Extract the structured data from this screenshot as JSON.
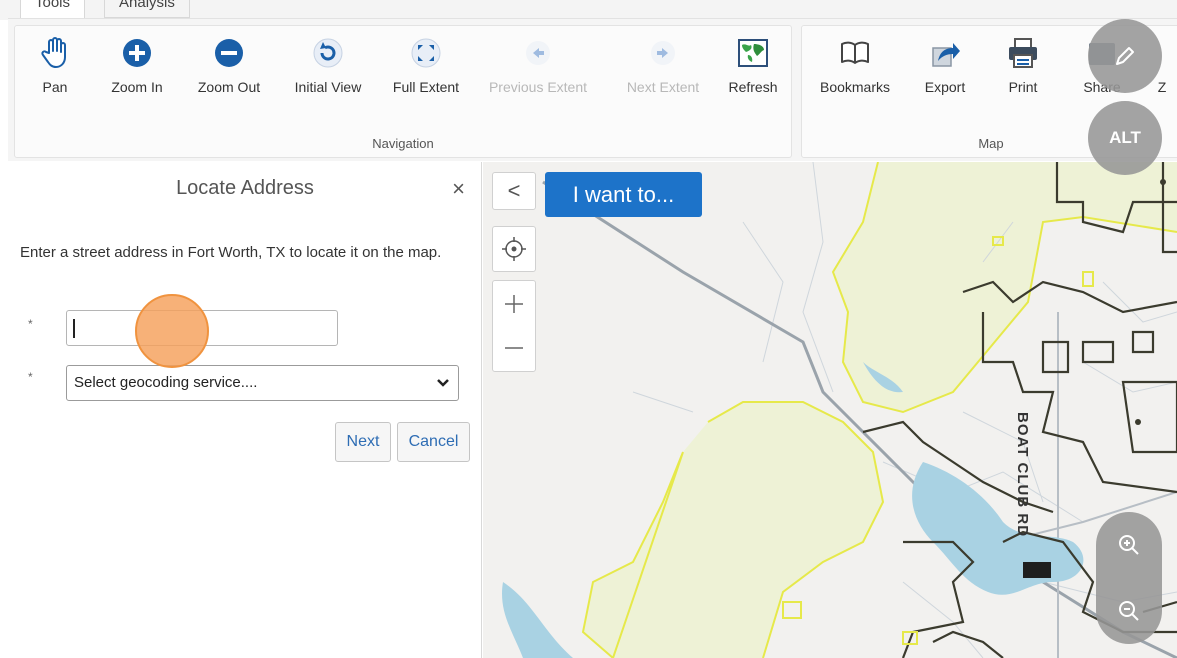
{
  "tabs": [
    {
      "label": "Tools",
      "active": true
    },
    {
      "label": "Analysis",
      "active": false
    }
  ],
  "ribbon": {
    "navigation": {
      "label": "Navigation",
      "tools": [
        {
          "label": "Pan",
          "icon": "hand-icon",
          "enabled": true
        },
        {
          "label": "Zoom In",
          "icon": "zoom-in-icon",
          "enabled": true
        },
        {
          "label": "Zoom Out",
          "icon": "zoom-out-icon",
          "enabled": true
        },
        {
          "label": "Initial View",
          "icon": "initial-view-icon",
          "enabled": true
        },
        {
          "label": "Full Extent",
          "icon": "full-extent-icon",
          "enabled": true
        },
        {
          "label": "Previous Extent",
          "icon": "arrow-left-icon",
          "enabled": false
        },
        {
          "label": "Next Extent",
          "icon": "arrow-right-icon",
          "enabled": false
        },
        {
          "label": "Refresh",
          "icon": "globe-refresh-icon",
          "enabled": true
        }
      ]
    },
    "map": {
      "label": "Map",
      "tools": [
        {
          "label": "Bookmarks",
          "icon": "book-icon"
        },
        {
          "label": "Export",
          "icon": "export-icon"
        },
        {
          "label": "Print",
          "icon": "printer-icon"
        },
        {
          "label": "Share",
          "icon": "share-icon"
        }
      ],
      "overflow_label": "Z"
    }
  },
  "panel": {
    "title": "Locate Address",
    "close": "×",
    "description": "Enter a street address in Fort Worth, TX to locate it on the map.",
    "required_mark": "*",
    "address_value": "",
    "geocoder_selected": "Select geocoding service....",
    "next_label": "Next",
    "cancel_label": "Cancel"
  },
  "map": {
    "collapse_icon": "<",
    "i_want_to": "I want to...",
    "road_label": "BOAT CLUB RD"
  },
  "overlay": {
    "alt_label": "ALT"
  },
  "colors": {
    "accent": "#1d73c9",
    "boundary_yellow": "#e6e94a",
    "park_fill": "#eef2d6",
    "water": "#a9d2e3",
    "click_marker": "#f5a05a"
  }
}
